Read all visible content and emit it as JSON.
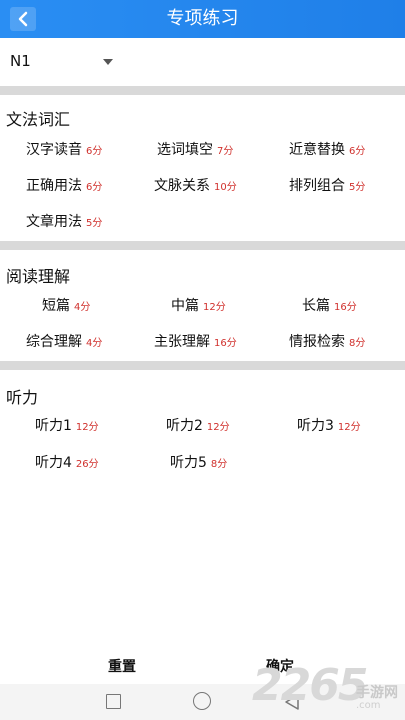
{
  "header": {
    "title": "专项练习",
    "back_icon": "chevron-left-icon"
  },
  "level_selector": {
    "value": "N1",
    "icon": "dropdown-triangle-icon"
  },
  "sections": [
    {
      "title": "文法词汇",
      "items": [
        {
          "label": "汉字读音",
          "score": "6分"
        },
        {
          "label": "选词填空",
          "score": "7分"
        },
        {
          "label": "近意替换",
          "score": "6分"
        },
        {
          "label": "正确用法",
          "score": "6分"
        },
        {
          "label": "文脉关系",
          "score": "10分"
        },
        {
          "label": "排列组合",
          "score": "5分"
        },
        {
          "label": "文章用法",
          "score": "5分"
        }
      ]
    },
    {
      "title": "阅读理解",
      "items": [
        {
          "label": "短篇",
          "score": "4分"
        },
        {
          "label": "中篇",
          "score": "12分"
        },
        {
          "label": "长篇",
          "score": "16分"
        },
        {
          "label": "综合理解",
          "score": "4分"
        },
        {
          "label": "主张理解",
          "score": "16分"
        },
        {
          "label": "情报检索",
          "score": "8分"
        }
      ]
    },
    {
      "title": "听力",
      "items": [
        {
          "label": "听力1",
          "score": "12分"
        },
        {
          "label": "听力2",
          "score": "12分"
        },
        {
          "label": "听力3",
          "score": "12分"
        },
        {
          "label": "听力4",
          "score": "26分"
        },
        {
          "label": "听力5",
          "score": "8分"
        }
      ]
    }
  ],
  "footer": {
    "reset_label": "重置",
    "confirm_label": "确定"
  },
  "watermark": {
    "number": "2265",
    "site": "手游网",
    "domain": ".com"
  },
  "colors": {
    "header": "#1f7fe8",
    "score": "#d0312d",
    "divider": "#d9d9d9"
  }
}
